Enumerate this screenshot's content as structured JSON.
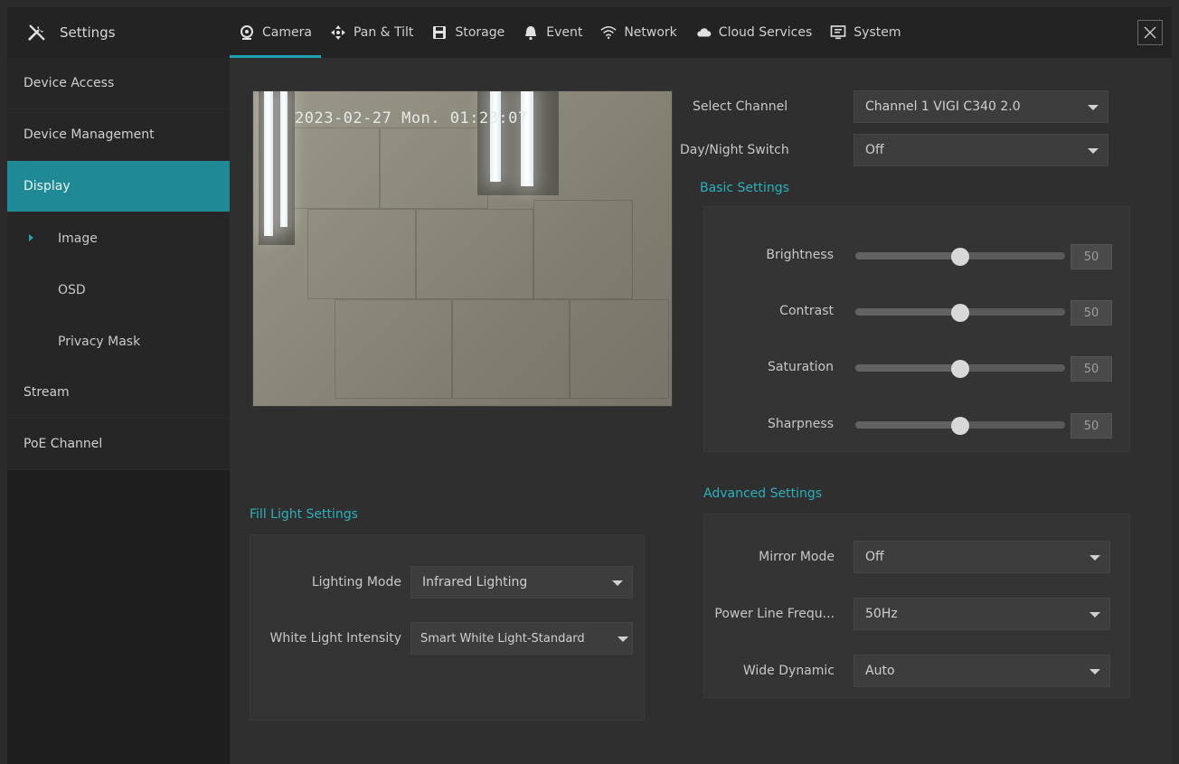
{
  "brand": {
    "title": "Settings",
    "icon": "tools-icon"
  },
  "tabs": [
    {
      "label": "Camera",
      "icon": "camera-icon",
      "active": true
    },
    {
      "label": "Pan & Tilt",
      "icon": "pan-tilt-icon",
      "active": false
    },
    {
      "label": "Storage",
      "icon": "storage-icon",
      "active": false
    },
    {
      "label": "Event",
      "icon": "bell-icon",
      "active": false
    },
    {
      "label": "Network",
      "icon": "wifi-icon",
      "active": false
    },
    {
      "label": "Cloud Services",
      "icon": "cloud-icon",
      "active": false
    },
    {
      "label": "System",
      "icon": "monitor-icon",
      "active": false
    }
  ],
  "sidebar": {
    "items": [
      {
        "label": "Device Access"
      },
      {
        "label": "Device Management"
      },
      {
        "label": "Display"
      },
      {
        "label": "Image"
      },
      {
        "label": "OSD"
      },
      {
        "label": "Privacy Mask"
      },
      {
        "label": "Stream"
      },
      {
        "label": "PoE Channel"
      }
    ]
  },
  "preview": {
    "osd": "2023-02-27 Mon. 01:23:07"
  },
  "channel": {
    "select_label": "Select Channel",
    "select_value": "Channel 1 VIGI C340 2.0",
    "daynight_label": "Day/Night Switch",
    "daynight_value": "Off"
  },
  "basic": {
    "title": "Basic Settings",
    "sliders": [
      {
        "label": "Brightness",
        "value": "50",
        "fraction": 0.5
      },
      {
        "label": "Contrast",
        "value": "50",
        "fraction": 0.5
      },
      {
        "label": "Saturation",
        "value": "50",
        "fraction": 0.5
      },
      {
        "label": "Sharpness",
        "value": "50",
        "fraction": 0.5
      }
    ]
  },
  "advanced": {
    "title": "Advanced Settings",
    "mirror_label": "Mirror Mode",
    "mirror_value": "Off",
    "power_label": "Power Line Frequ...",
    "power_value": "50Hz",
    "wdr_label": "Wide Dynamic",
    "wdr_value": "Auto"
  },
  "fill_light": {
    "title": "Fill Light Settings",
    "mode_label": "Lighting Mode",
    "mode_value": "Infrared Lighting",
    "intensity_label": "White Light Intensity",
    "intensity_value": "Smart White Light-Standard"
  },
  "colors": {
    "accent": "#1fa3b0",
    "sidebar_active": "#1f8a96"
  }
}
